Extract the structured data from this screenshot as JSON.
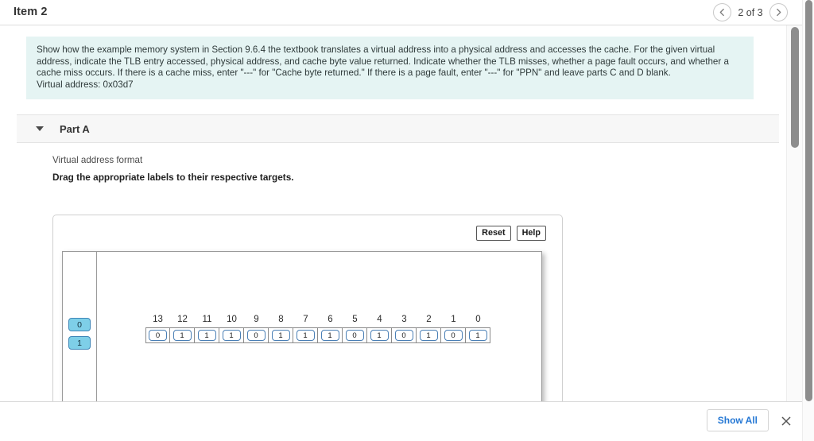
{
  "header": {
    "title": "Item 2",
    "pager": {
      "prev_icon": "chevron-left-icon",
      "next_icon": "chevron-right-icon",
      "count": "2 of 3"
    }
  },
  "prompt": {
    "body": "Show how the example memory system in Section 9.6.4 the textbook translates a virtual address into a physical address and accesses the cache. For the given virtual address, indicate the TLB entry accessed, physical address, and cache byte value returned. Indicate whether the TLB misses, whether a page fault occurs, and whether a cache miss occurs. If there is a cache miss, enter \"---\" for \"Cache byte returned.\" If there is a page fault, enter \"---\" for \"PPN\" and leave parts C and D blank.",
    "virtual_address_line": "Virtual address: 0x03d7"
  },
  "part": {
    "caret_icon": "caret-down-icon",
    "label": "Part A",
    "sub_label": "Virtual address format",
    "instruction": "Drag the appropriate labels to their respective targets."
  },
  "dragdrop": {
    "reset_label": "Reset",
    "help_label": "Help",
    "source_tiles": [
      "0",
      "1"
    ],
    "bit_numbers": [
      "13",
      "12",
      "11",
      "10",
      "9",
      "8",
      "7",
      "6",
      "5",
      "4",
      "3",
      "2",
      "1",
      "0"
    ],
    "bit_values": [
      "0",
      "1",
      "1",
      "1",
      "0",
      "1",
      "1",
      "1",
      "0",
      "1",
      "0",
      "1",
      "0",
      "1"
    ]
  },
  "footer": {
    "show_all_label": "Show All",
    "close_icon": "close-icon"
  },
  "colors": {
    "prompt_bg": "#e5f4f3",
    "source_tile": "#7ecfe8",
    "link": "#2477d4"
  }
}
